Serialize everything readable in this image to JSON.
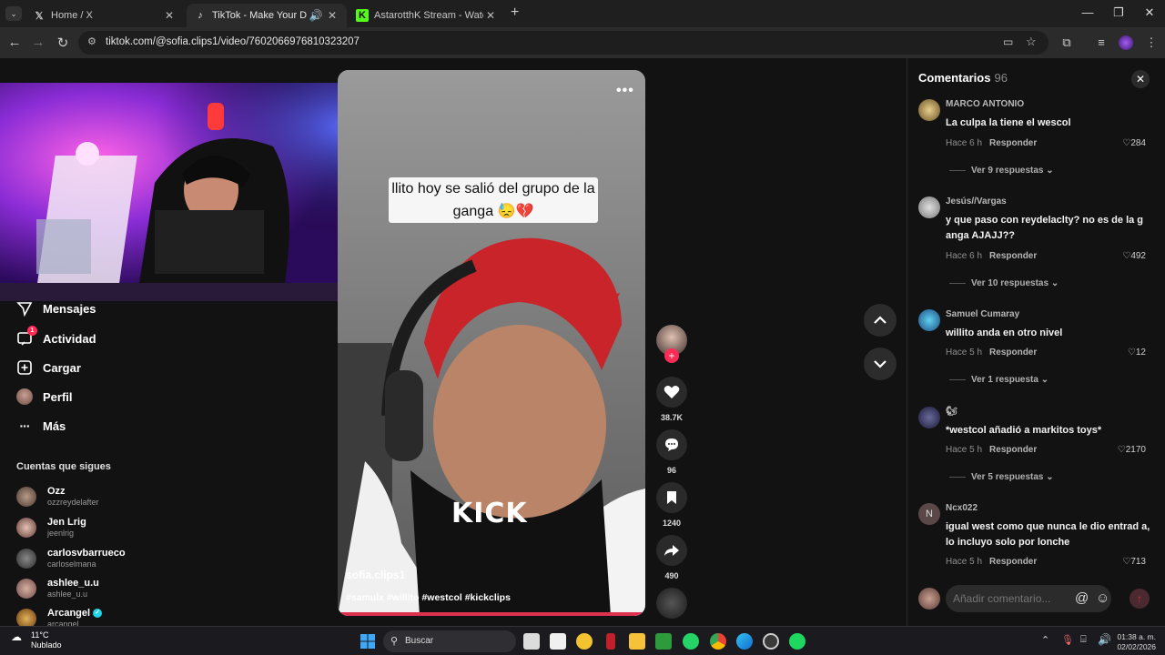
{
  "browser": {
    "tabs": [
      {
        "title": "Home / X",
        "favicon": "x-logo"
      },
      {
        "title": "TikTok - Make Your Day",
        "favicon": "tiktok-logo"
      },
      {
        "title": "AstarotthK Stream - Watch Live on Kick",
        "favicon": "kick-logo"
      }
    ],
    "url": "tiktok.com/@sofia.clips1/video/7602066976810323207"
  },
  "sidebar": {
    "nav": [
      {
        "label": "Mensajes",
        "icon": "paper-plane-icon"
      },
      {
        "label": "Actividad",
        "icon": "inbox-icon",
        "badge": "1"
      },
      {
        "label": "Cargar",
        "icon": "plus-square-icon"
      },
      {
        "label": "Perfil",
        "icon": "avatar"
      },
      {
        "label": "Más",
        "icon": "ellipsis-icon"
      }
    ],
    "following_title": "Cuentas que sigues",
    "following": [
      {
        "name": "Ozz",
        "handle": "ozzreydelafter"
      },
      {
        "name": "Jen Lrig",
        "handle": "jeenlrig"
      },
      {
        "name": "carlosvbarrueco",
        "handle": "carloselmana"
      },
      {
        "name": "ashlee_u.u",
        "handle": "ashlee_u.u"
      },
      {
        "name": "Arcangel",
        "handle": "arcangel"
      }
    ]
  },
  "video": {
    "caption": "llito hoy se salió del grupo de la ganga 😓💔",
    "watermark": "KICK",
    "username": "sofia.clips1",
    "hashtags": "#samulx #willito #westcol #kickclips",
    "more": "•••"
  },
  "actions": {
    "likes": "38.7K",
    "comments": "96",
    "saves": "1240",
    "shares": "490"
  },
  "comments": {
    "title": "Comentarios",
    "count": "96",
    "items": [
      {
        "author": "MARCO ANTONIO",
        "text": "La culpa la tiene el wescol",
        "time": "Hace 6 h",
        "reply": "Responder",
        "likes": "284",
        "replies": "Ver 9 respuestas"
      },
      {
        "author": "Jesús//Vargas",
        "text": "y que paso con reydelaclty? no es de la g anga AJAJJ??",
        "time": "Hace 6 h",
        "reply": "Responder",
        "likes": "492",
        "replies": "Ver 10 respuestas"
      },
      {
        "author": "Samuel Cumaray",
        "text": "willito anda en otro nivel",
        "time": "Hace 5 h",
        "reply": "Responder",
        "likes": "12",
        "replies": "Ver 1 respuesta"
      },
      {
        "author": "🐿",
        "text": "*westcol añadió a markitos toys*",
        "time": "Hace 5 h",
        "reply": "Responder",
        "likes": "2170",
        "replies": "Ver 5 respuestas"
      },
      {
        "author": "Ncx022",
        "text": "igual west como que nunca le dio entrad a, lo incluyo solo por lonche",
        "time": "Hace 5 h",
        "reply": "Responder",
        "likes": "713",
        "replies": ""
      }
    ],
    "input_placeholder": "Añadir comentario..."
  },
  "taskbar": {
    "weather_temp": "11°C",
    "weather_desc": "Nublado",
    "search": "Buscar",
    "time": "01:38 a. m.",
    "date": "02/02/2026"
  }
}
